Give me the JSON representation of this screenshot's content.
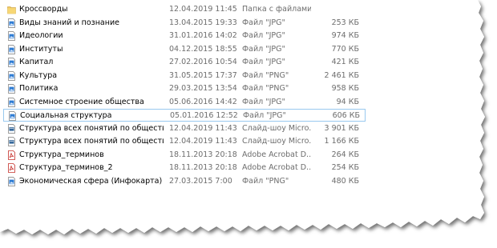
{
  "files": [
    {
      "name": "Кроссворды",
      "date": "12.04.2019 11:45",
      "type": "Папка с файлами",
      "size": "",
      "icon": "folder-icon"
    },
    {
      "name": "Виды знаний и познание",
      "date": "13.04.2015 19:33",
      "type": "Файл \"JPG\"",
      "size": "253 КБ",
      "icon": "image-file-icon"
    },
    {
      "name": "Идеологии",
      "date": "31.01.2016 14:02",
      "type": "Файл \"JPG\"",
      "size": "974 КБ",
      "icon": "image-file-icon"
    },
    {
      "name": "Институты",
      "date": "04.12.2015 18:55",
      "type": "Файл \"JPG\"",
      "size": "770 КБ",
      "icon": "image-file-icon"
    },
    {
      "name": "Капитал",
      "date": "27.02.2016 10:54",
      "type": "Файл \"JPG\"",
      "size": "421 КБ",
      "icon": "image-file-icon"
    },
    {
      "name": "Культура",
      "date": "31.05.2015 17:37",
      "type": "Файл \"PNG\"",
      "size": "2 461 КБ",
      "icon": "image-file-icon"
    },
    {
      "name": "Политика",
      "date": "29.03.2015 13:54",
      "type": "Файл \"PNG\"",
      "size": "958 КБ",
      "icon": "image-file-icon"
    },
    {
      "name": "Системное строение общества",
      "date": "05.06.2016 14:42",
      "type": "Файл \"JPG\"",
      "size": "94 КБ",
      "icon": "image-file-icon"
    },
    {
      "name": "Социальная структура",
      "date": "05.01.2016 12:52",
      "type": "Файл \"JPG\"",
      "size": "606 КБ",
      "icon": "image-file-icon",
      "selected": true
    },
    {
      "name": "Структура всех понятий по обществу",
      "date": "12.04.2019 11:43",
      "type": "Слайд-шоу Micro...",
      "size": "3 901 КБ",
      "icon": "slideshow-file-icon"
    },
    {
      "name": "Структура всех понятий по обществу",
      "date": "12.04.2019 11:43",
      "type": "Слайд-шоу Micro...",
      "size": "1 166 КБ",
      "icon": "slideshow-file-icon"
    },
    {
      "name": "Структура_терминов",
      "date": "18.11.2013 20:18",
      "type": "Adobe Acrobat D...",
      "size": "264 КБ",
      "icon": "pdf-file-icon"
    },
    {
      "name": "Структура_терминов_2",
      "date": "18.11.2013 20:18",
      "type": "Adobe Acrobat D...",
      "size": "254 КБ",
      "icon": "pdf-file-icon"
    },
    {
      "name": "Экономическая сфера (Инфокарта)",
      "date": "27.03.2015 7:00",
      "type": "Файл \"PNG\"",
      "size": "480 КБ",
      "icon": "image-file-icon"
    }
  ],
  "colors": {
    "selection_border": "#99c9ef",
    "folder": "#f0c75e",
    "image_icon": "#2f7cd3",
    "slideshow_icon": "#36689b",
    "pdf_icon": "#c5302a"
  }
}
